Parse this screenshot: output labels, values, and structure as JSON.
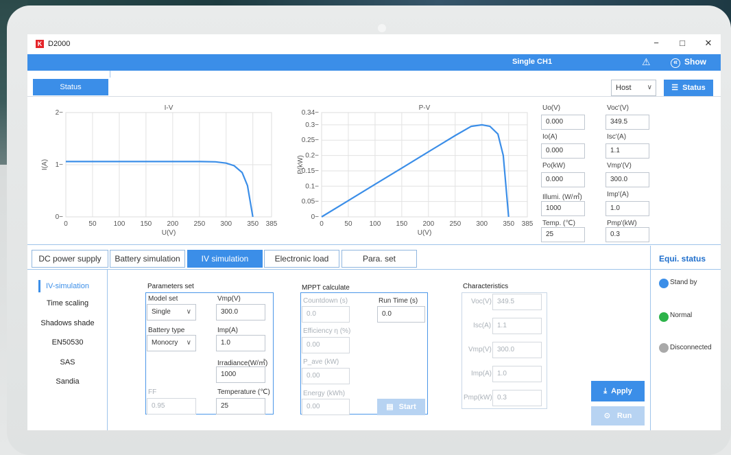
{
  "window": {
    "title": "D2000",
    "logo": "K",
    "minimize": "−",
    "maximize": "□",
    "close": "✕"
  },
  "header": {
    "mode": "Single CH1",
    "warning_icon": "⚠",
    "show_label": "Show",
    "show_icon": "«"
  },
  "toolbar": {
    "status_tab": "Status",
    "host_select": "Host",
    "status_button": "Status"
  },
  "chart_data": [
    {
      "type": "line",
      "title": "I-V",
      "xlabel": "U(V)",
      "ylabel": "I(A)",
      "xlim": [
        0,
        385
      ],
      "ylim": [
        0,
        2
      ],
      "xticks": [
        "0",
        "50",
        "100",
        "150",
        "200",
        "250",
        "300",
        "350",
        "385"
      ],
      "yticks": [
        "0",
        "1",
        "2"
      ],
      "x": [
        0,
        50,
        100,
        150,
        200,
        250,
        280,
        300,
        315,
        330,
        340,
        345,
        350
      ],
      "y": [
        1.06,
        1.06,
        1.06,
        1.06,
        1.06,
        1.06,
        1.055,
        1.03,
        0.98,
        0.85,
        0.6,
        0.3,
        0.0
      ]
    },
    {
      "type": "line",
      "title": "P-V",
      "xlabel": "U(V)",
      "ylabel": "P(kW)",
      "xlim": [
        0,
        385
      ],
      "ylim": [
        0,
        0.34
      ],
      "xticks": [
        "0",
        "50",
        "100",
        "150",
        "200",
        "250",
        "300",
        "350",
        "385"
      ],
      "yticks": [
        "0",
        "0.05",
        "0.1",
        "0.15",
        "0.2",
        "0.25",
        "0.3",
        "0.34"
      ],
      "x": [
        0,
        50,
        100,
        150,
        200,
        250,
        280,
        300,
        315,
        330,
        340,
        345,
        350
      ],
      "y": [
        0,
        0.053,
        0.106,
        0.159,
        0.212,
        0.265,
        0.295,
        0.3,
        0.295,
        0.27,
        0.2,
        0.1,
        0.0
      ]
    }
  ],
  "readings": {
    "uo_label": "Uo(V)",
    "uo": "0.000",
    "voc_label": "Voc'(V)",
    "voc": "349.5",
    "io_label": "Io(A)",
    "io": "0.000",
    "isc_label": "Isc'(A)",
    "isc": "1.1",
    "po_label": "Po(kW)",
    "po": "0.000",
    "vmp_label": "Vmp'(V)",
    "vmp": "300.0",
    "illum_label": "Illumi. (W/㎡)",
    "illum": "1000",
    "imp_label": "Imp'(A)",
    "imp": "1.0",
    "temp_label": "Temp. (℃)",
    "temp": "25",
    "pmp_label": "Pmp'(kW)",
    "pmp": "0.3"
  },
  "tabs": [
    "DC power supply",
    "Battery simulation",
    "IV simulation",
    "Electronic load",
    "Para. set"
  ],
  "equi": {
    "title": "Equi. status",
    "standby": "Stand by",
    "normal": "Normal",
    "disconnected": "Disconnected",
    "colors": {
      "standby": "#3b8ee8",
      "normal": "#2db34a",
      "disconnected": "#a9a9a9"
    }
  },
  "nav": [
    "IV-simulation",
    "Time scaling",
    "Shadows shade",
    "EN50530",
    "SAS",
    "Sandia"
  ],
  "params": {
    "title": "Parameters set",
    "model_label": "Model set",
    "model": "Single",
    "vmp_label": "Vmp(V)",
    "vmp": "300.0",
    "battery_label": "Battery type",
    "battery": "Monocry",
    "imp_label": "Imp(A)",
    "imp": "1.0",
    "irr_label": "Irradiance(W/㎡)",
    "irr": "1000",
    "ff_label": "FF",
    "ff": "0.95",
    "temp_label": "Temperature (℃)",
    "temp": "25"
  },
  "mppt": {
    "title": "MPPT calculate",
    "countdown_label": "Countdown (s)",
    "countdown": "0.0",
    "runtime_label": "Run Time (s)",
    "runtime": "0.0",
    "eff_label": "Efficiency η (%)",
    "eff": "0.00",
    "pave_label": "P_ave (kW)",
    "pave": "0.00",
    "energy_label": "Energy (kWh)",
    "energy": "0.00",
    "start": "Start"
  },
  "chars": {
    "title": "Characteristics",
    "voc_label": "Voc(V)",
    "voc": "349.5",
    "isc_label": "Isc(A)",
    "isc": "1.1",
    "vmp_label": "Vmp(V)",
    "vmp": "300.0",
    "imp_label": "Imp(A)",
    "imp": "1.0",
    "pmp_label": "Pmp(kW)",
    "pmp": "0.3"
  },
  "actions": {
    "apply": "Apply",
    "run": "Run"
  }
}
